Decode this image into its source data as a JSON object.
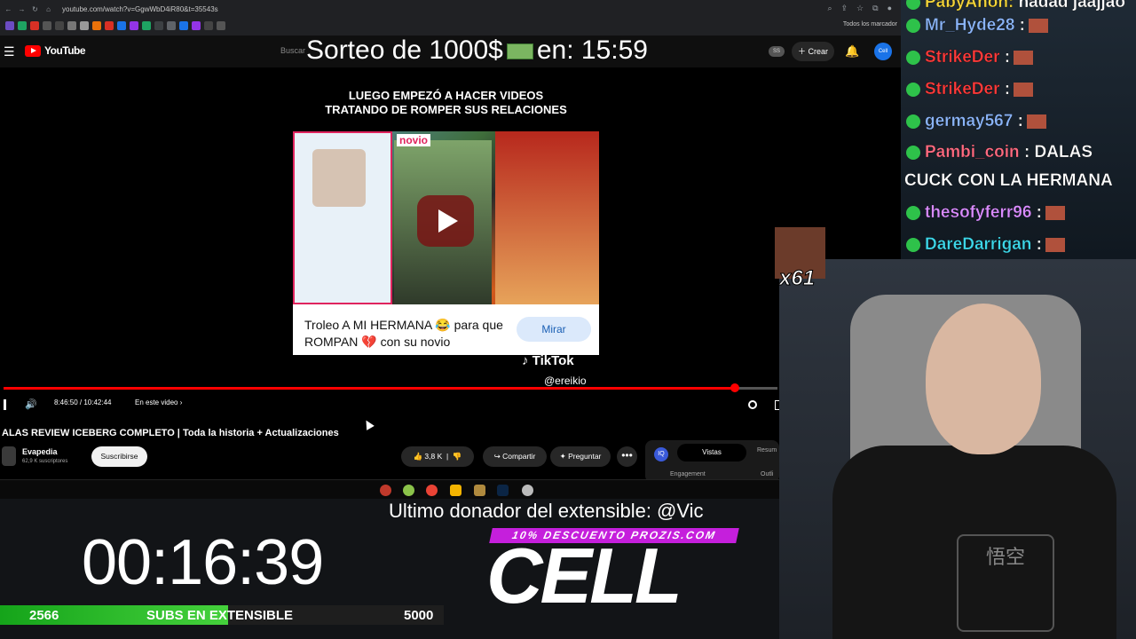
{
  "browser": {
    "url": "youtube.com/watch?v=GgwWbD4iR80&t=35543s",
    "bookmarks_folder": "Todos los marcador"
  },
  "youtube": {
    "logo_text": "YouTube",
    "search_placeholder": "Buscar",
    "create_label": "Crear",
    "ss_badge": "SS",
    "avatar_text": "Cell"
  },
  "overlay": {
    "raffle_left": "Sorteo de 1000$",
    "raffle_right": "en:  15:59"
  },
  "video": {
    "caption_line1": "LUEGO EMPEZÓ A HACER VIDEOS",
    "caption_line2": "TRATANDO DE ROMPER SUS RELACIONES",
    "thumb_tag": "novio",
    "card_text": "Troleo A MI HERMANA 😂 para que ROMPAN 💔 con su novio",
    "card_button": "Mirar",
    "tiktok_label": "TikTok",
    "tiktok_handle": "@ereikio",
    "time": "8:46:50 / 10:42:44",
    "progress": 0.945,
    "chapter": "En este video",
    "title": "ALAS REVIEW ICEBERG COMPLETO | Toda la historia + Actualizaciones"
  },
  "channel": {
    "name": "Evapedia",
    "subs": "62,9 K suscriptores",
    "subscribe_label": "Suscribirse"
  },
  "actions": {
    "likes": "3,8 K",
    "share": "Compartir",
    "ask": "Preguntar",
    "more": "•••"
  },
  "panel": {
    "logo": "IQ",
    "tab_views": "Vistas",
    "tab_summary": "Resum",
    "engagement": "Engagement",
    "outline": "Outli"
  },
  "stream": {
    "donor": "Ultimo donador del extensible: @Vic",
    "discount": "10% DESCUENTO PROZIS.COM",
    "brand": "CELL",
    "timer": "00:16:39",
    "subs_count": "2566",
    "subs_label": "SUBS EN EXTENSIBLE",
    "subs_goal": "5000",
    "subs_progress": 0.513,
    "emote_count": "x61"
  },
  "chat": [
    {
      "user": "PabyAnon:",
      "msg": "ñadad jaajjao",
      "color": "#f2d43a"
    },
    {
      "user": "Mr_Hyde28",
      "msg": ":",
      "color": "#8ab4f8"
    },
    {
      "user": "StrikeDer",
      "msg": ":",
      "color": "#ff3b3b"
    },
    {
      "user": "StrikeDer",
      "msg": ":",
      "color": "#ff3b3b"
    },
    {
      "user": "germay567",
      "msg": ":",
      "color": "#8ab4f8"
    },
    {
      "user": "Pambi_coin",
      "msg": ": DALAS",
      "color": "#ff6b81"
    },
    {
      "user": "",
      "msg": "CUCK CON LA HERMANA",
      "color": "#ffffff"
    },
    {
      "user": "thesofyferr96",
      "msg": ":",
      "color": "#d98cff"
    },
    {
      "user": "DareDarrigan",
      "msg": ":",
      "color": "#3dd6e8"
    }
  ],
  "cam": {
    "shirt_print": "悟空"
  }
}
